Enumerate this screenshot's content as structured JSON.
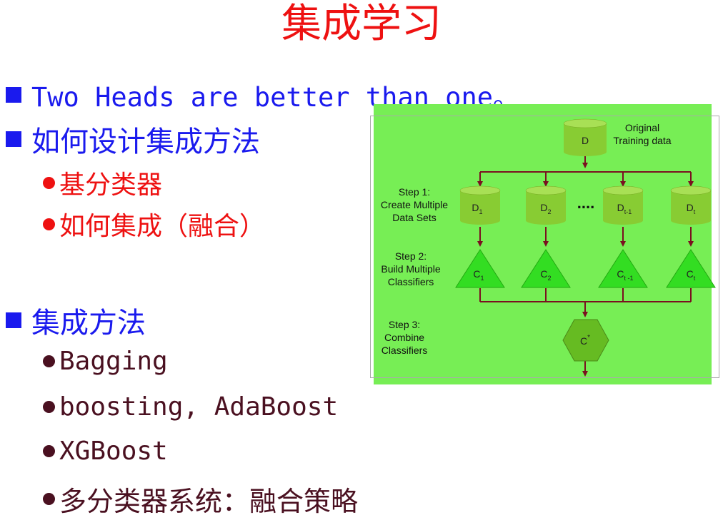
{
  "title": "集成学习",
  "bullets": [
    {
      "text": "Two Heads are better than one。"
    },
    {
      "text": "如何设计集成方法",
      "sub": [
        "基分类器",
        "如何集成（融合）"
      ]
    },
    {
      "text": "集成方法",
      "sub": [
        "Bagging",
        "boosting, AdaBoost",
        "XGBoost",
        "多分类器系统：融合策略"
      ]
    }
  ],
  "diagram": {
    "original_label_1": "Original",
    "original_label_2": "Training data",
    "original_node": "D",
    "step1": [
      "Step 1:",
      "Create Multiple",
      "Data Sets"
    ],
    "step2": [
      "Step 2:",
      "Build Multiple",
      "Classifiers"
    ],
    "step3": [
      "Step 3:",
      "Combine",
      "Classifiers"
    ],
    "datasets": [
      {
        "main": "D",
        "sub": "1"
      },
      {
        "main": "D",
        "sub": "2"
      },
      {
        "main": "D",
        "sub": "t-1"
      },
      {
        "main": "D",
        "sub": "t"
      }
    ],
    "ellipsis": "....",
    "classifiers": [
      {
        "main": "C",
        "sub": "1"
      },
      {
        "main": "C",
        "sub": "2"
      },
      {
        "main": "C",
        "sub": "t -1"
      },
      {
        "main": "C",
        "sub": "t"
      }
    ],
    "combined": {
      "main": "C",
      "sup": "*"
    },
    "colors": {
      "background": "#77ee55",
      "shape_fill": "#88cc33",
      "triangle_fill": "#33dd22",
      "hexagon_fill": "#66bb22",
      "arrow": "#7a1020"
    }
  }
}
